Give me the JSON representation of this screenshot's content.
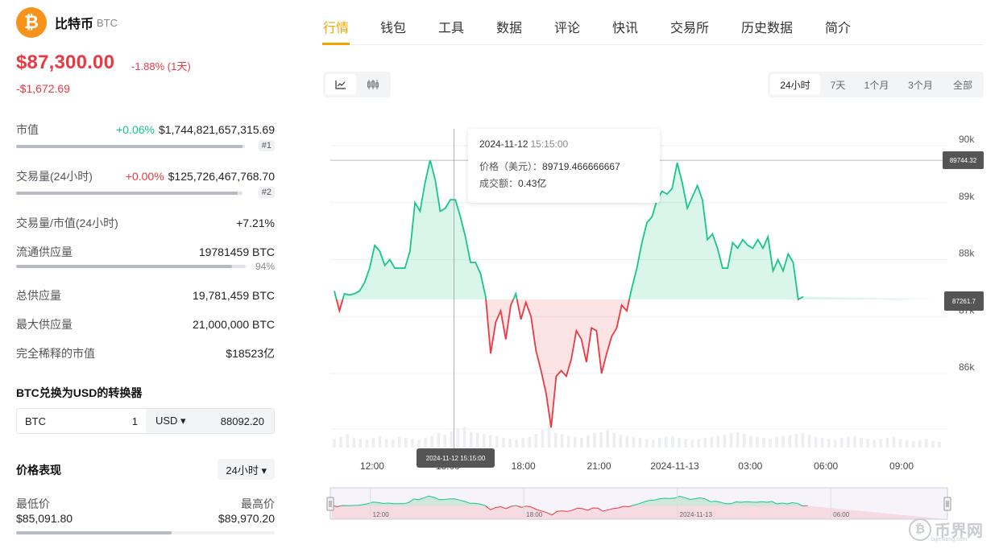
{
  "coin": {
    "name": "比特币",
    "symbol": "BTC",
    "logo_glyph": "₿",
    "price": "$87,300.00",
    "change_pct": "-1.88% (1天)",
    "change_abs": "-$1,672.69"
  },
  "stats": {
    "market_cap": {
      "label": "市值",
      "change": "+0.06%",
      "value": "$1,744,821,657,315.69",
      "rank": "#1",
      "bar_fraction": 0.99
    },
    "volume": {
      "label": "交易量(24小时)",
      "change": "+0.00%",
      "value": "$125,726,467,768.70",
      "rank": "#2",
      "bar_fraction": 0.98
    },
    "vol_mcap": {
      "label": "交易量/市值(24小时)",
      "value": "+7.21%"
    },
    "circulating": {
      "label": "流通供应量",
      "value": "19781459 BTC",
      "pct": "94%",
      "bar_fraction": 0.94
    },
    "total_supply": {
      "label": "总供应量",
      "value": "19,781,459 BTC"
    },
    "max_supply": {
      "label": "最大供应量",
      "value": "21,000,000 BTC"
    },
    "fdv": {
      "label": "完全稀释的市值",
      "value": "$18523亿"
    }
  },
  "converter": {
    "title": "BTC兑换为USD的转换器",
    "from_currency": "BTC",
    "from_amount": "1",
    "to_currency": "USD ▾",
    "to_amount": "88092.20"
  },
  "performance": {
    "title": "价格表现",
    "period": "24小时 ▾",
    "low_label": "最低价",
    "low_value": "$85,091.80",
    "high_label": "最高价",
    "high_value": "$89,970.20",
    "position_fraction": 0.6
  },
  "tabs": [
    "行情",
    "钱包",
    "工具",
    "数据",
    "评论",
    "快讯",
    "交易所",
    "历史数据",
    "简介"
  ],
  "active_tab": 0,
  "chart_type_buttons": [
    {
      "icon": "line-chart-icon",
      "active": true
    },
    {
      "icon": "candlestick-icon",
      "active": false
    }
  ],
  "ranges": [
    "24小时",
    "7天",
    "1个月",
    "3个月",
    "全部"
  ],
  "active_range": 0,
  "tooltip": {
    "date": "2024-11-12",
    "time": "15:15:00",
    "price_label": "价格（美元）：",
    "price": "89719.466666667",
    "volume_label": "成交额：",
    "volume": "0.43亿"
  },
  "crosshair_label": "2024-11-12 15:15:00",
  "price_tags": {
    "hover": "89744.32",
    "current": "87261.7"
  },
  "watermark": "币界网",
  "watermark_sub": "bijiewang.com",
  "colors": {
    "up": "#16c784",
    "down": "#ea3943",
    "accent": "#f0a500"
  },
  "chart_data": {
    "type": "area",
    "baseline": 87300,
    "y_ticks": [
      "90k",
      "89k",
      "88k",
      "87k",
      "86k"
    ],
    "y_tick_values": [
      90000,
      89000,
      88000,
      87000,
      86000
    ],
    "x_ticks": [
      "12:00",
      "15:00",
      "18:00",
      "21:00",
      "2024-11-13",
      "03:00",
      "06:00",
      "09:00"
    ],
    "x_tick_hours": [
      1.5,
      4.5,
      7.5,
      10.5,
      13.5,
      16.5,
      19.5,
      22.5
    ],
    "navigator_ticks": [
      "12:00",
      "18:00",
      "2024-11-13",
      "06:00"
    ],
    "navigator_tick_hours": [
      1.5,
      7.5,
      13.5,
      19.5
    ],
    "crosshair_hour": 4.75,
    "series": [
      {
        "hours": [
          0,
          0.2,
          0.4,
          0.6,
          0.8,
          1.0,
          1.2,
          1.4,
          1.6,
          1.8,
          2.0,
          2.2,
          2.4,
          2.6,
          2.8,
          3.0,
          3.2,
          3.4,
          3.6,
          3.8,
          4.0,
          4.2,
          4.4,
          4.6,
          4.8,
          5.0,
          5.2,
          5.4,
          5.6,
          5.8,
          6.0,
          6.2,
          6.4,
          6.6,
          6.8,
          7.0,
          7.2,
          7.4,
          7.6,
          7.8,
          8.0,
          8.2,
          8.4,
          8.6,
          8.8,
          9.0,
          9.2,
          9.4,
          9.6,
          9.8,
          10.0,
          10.2,
          10.4,
          10.6,
          10.8,
          11.0,
          11.2,
          11.4,
          11.6,
          11.8,
          12.0,
          12.2,
          12.4,
          12.6,
          12.8,
          13.0,
          13.2,
          13.4,
          13.6,
          13.8,
          14.0,
          14.2,
          14.4,
          14.6,
          14.8,
          15.0,
          15.2,
          15.4,
          15.6,
          15.8,
          16.0,
          16.2,
          16.4,
          16.6,
          16.8,
          17.0,
          17.2,
          17.4,
          17.6,
          17.8,
          18.0,
          18.2,
          18.4,
          18.6,
          18.8,
          19.0,
          19.2,
          19.4,
          19.6,
          19.8,
          20.0,
          20.2,
          20.4,
          20.6,
          20.8,
          21.0,
          21.2,
          21.4,
          21.6,
          21.8,
          22.0,
          22.2,
          22.4,
          22.6,
          22.8,
          23.0,
          23.2,
          23.4,
          23.6,
          23.8,
          24.0
        ],
        "values": [
          87450,
          87100,
          87400,
          87380,
          87400,
          87450,
          87600,
          87850,
          88250,
          88150,
          87900,
          88000,
          87850,
          87850,
          87850,
          88150,
          89000,
          88850,
          89350,
          89750,
          89400,
          88850,
          88900,
          89050,
          89050,
          88750,
          88400,
          87950,
          87950,
          87750,
          87350,
          86350,
          86900,
          87100,
          86600,
          87200,
          87400,
          86950,
          87250,
          87000,
          86400,
          86050,
          85650,
          85050,
          85950,
          86050,
          85950,
          86250,
          86750,
          86600,
          86200,
          86800,
          86750,
          86000,
          86350,
          86650,
          86800,
          87200,
          87100,
          87500,
          87850,
          88300,
          88650,
          88750,
          89050,
          89200,
          89150,
          89250,
          89700,
          89350,
          88900,
          89100,
          89300,
          89050,
          88350,
          88450,
          88200,
          87850,
          87850,
          88300,
          88200,
          88350,
          88250,
          88200,
          88350,
          88200,
          88400,
          87800,
          88000,
          87800,
          88100,
          87950,
          87300,
          87350
        ],
        "volumes": [
          0.18,
          0.22,
          0.28,
          0.2,
          0.18,
          0.16,
          0.2,
          0.24,
          0.18,
          0.16,
          0.22,
          0.2,
          0.18,
          0.16,
          0.2,
          0.24,
          0.3,
          0.26,
          0.34,
          0.4,
          0.43,
          0.32,
          0.3,
          0.28,
          0.26,
          0.24,
          0.2,
          0.18,
          0.16,
          0.2,
          0.22,
          0.28,
          0.36,
          0.5,
          0.3,
          0.28,
          0.24,
          0.22,
          0.2,
          0.26,
          0.3,
          0.32,
          0.36,
          0.3,
          0.26,
          0.24,
          0.22,
          0.2,
          0.18,
          0.16,
          0.2,
          0.22,
          0.24,
          0.2,
          0.18,
          0.16,
          0.18,
          0.2,
          0.22,
          0.24,
          0.26,
          0.3,
          0.32,
          0.28,
          0.24,
          0.22,
          0.2,
          0.18,
          0.22,
          0.24,
          0.26,
          0.28,
          0.3,
          0.26,
          0.22,
          0.2,
          0.18,
          0.16,
          0.2,
          0.22,
          0.24,
          0.2,
          0.18,
          0.16,
          0.18,
          0.2,
          0.22,
          0.18,
          0.16,
          0.14,
          0.16,
          0.18,
          0.14,
          0.12
        ]
      }
    ]
  }
}
